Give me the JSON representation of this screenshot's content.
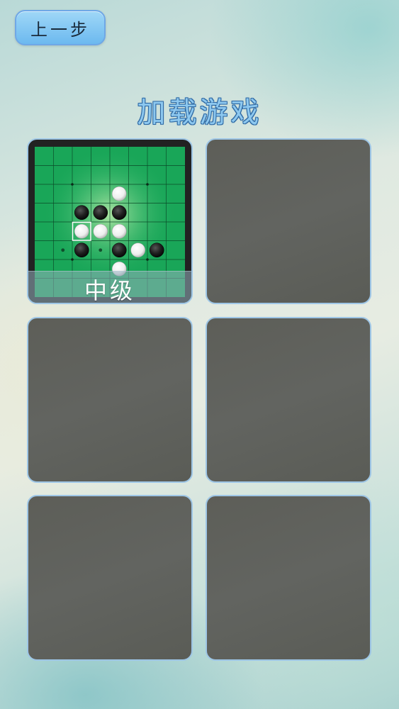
{
  "nav": {
    "back_label": "上一步"
  },
  "title": "加载游戏",
  "slots": [
    {
      "label": "中级",
      "board": {
        "size": 8,
        "stones": [
          {
            "row": 2,
            "col": 4,
            "color": "white"
          },
          {
            "row": 3,
            "col": 2,
            "color": "black"
          },
          {
            "row": 3,
            "col": 3,
            "color": "black"
          },
          {
            "row": 3,
            "col": 4,
            "color": "black"
          },
          {
            "row": 4,
            "col": 2,
            "color": "white"
          },
          {
            "row": 4,
            "col": 3,
            "color": "white"
          },
          {
            "row": 4,
            "col": 4,
            "color": "white"
          },
          {
            "row": 5,
            "col": 2,
            "color": "black"
          },
          {
            "row": 5,
            "col": 4,
            "color": "black"
          },
          {
            "row": 5,
            "col": 5,
            "color": "white"
          },
          {
            "row": 5,
            "col": 6,
            "color": "black"
          },
          {
            "row": 6,
            "col": 4,
            "color": "white"
          }
        ],
        "last_move": {
          "row": 4,
          "col": 2
        },
        "hints": [
          {
            "row": 5,
            "col": 1
          },
          {
            "row": 5,
            "col": 3
          }
        ]
      }
    },
    {
      "label": ""
    },
    {
      "label": ""
    },
    {
      "label": ""
    },
    {
      "label": ""
    },
    {
      "label": ""
    }
  ],
  "colors": {
    "board_green": "#19a658",
    "grid_line": "#0b4a28",
    "black_stone": "#1a1a1a",
    "white_stone": "#f4f4f4",
    "slot_border": "#9ec6e6",
    "title_fill": "#8dc8ef",
    "button_fill": "#7cc2f2"
  }
}
